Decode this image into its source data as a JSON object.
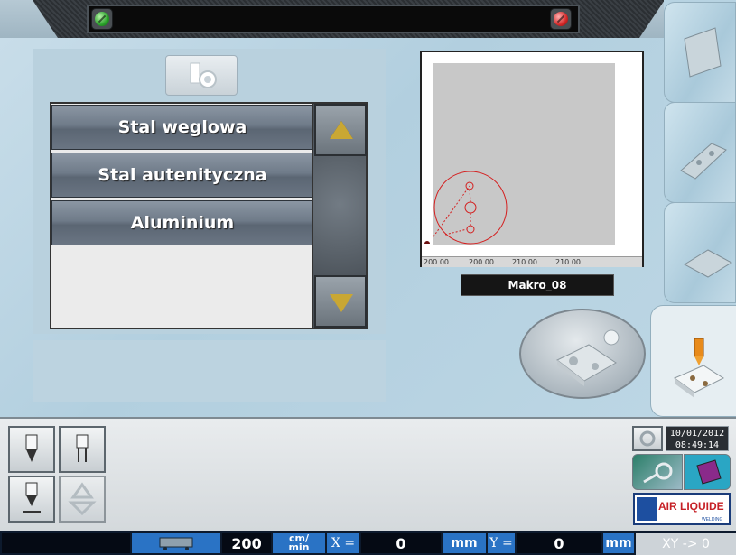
{
  "materials": {
    "items": [
      {
        "label": "Stal weglowa"
      },
      {
        "label": "Stal autenityczna"
      },
      {
        "label": "Aluminium"
      }
    ]
  },
  "preview": {
    "ruler": [
      "200.00",
      "200.00",
      "210.00",
      "210.00"
    ],
    "program_name": "Makro_08"
  },
  "datetime": {
    "date": "10/01/2012",
    "time": "08:49:14"
  },
  "brand": {
    "name": "AIR LIQUIDE",
    "sub": "WELDING"
  },
  "status_bar": {
    "speed_value": "200",
    "speed_unit_top": "cm/",
    "speed_unit_bottom": "min",
    "x_label": "X =",
    "x_value": "0",
    "x_unit": "mm",
    "y_label": "Y =",
    "y_value": "0",
    "y_unit": "mm",
    "reset_label": "XY -> 0"
  },
  "colors": {
    "accent_blue": "#2a73c5",
    "arrow_gold": "#c9a733",
    "contour_red": "#d42020"
  },
  "icons": [
    "torch-icon",
    "gas-cylinder-icon",
    "recycle-icon",
    "key-icon",
    "book-icon",
    "cutting-start-icon"
  ]
}
